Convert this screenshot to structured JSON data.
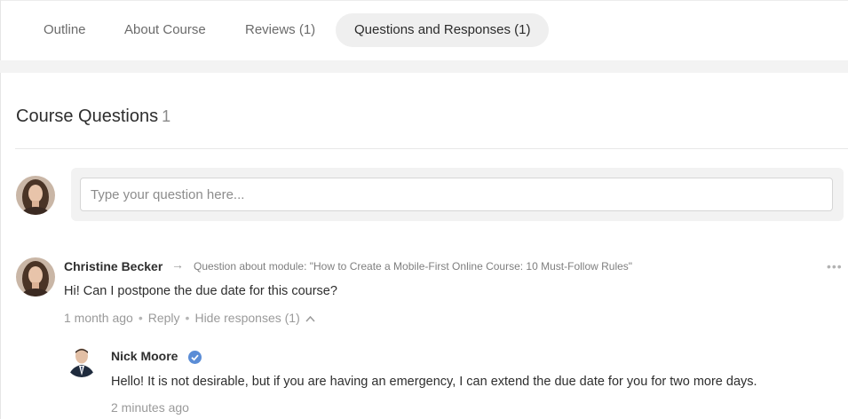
{
  "tabs": [
    {
      "label": "Outline"
    },
    {
      "label": "About Course"
    },
    {
      "label": "Reviews (1)"
    },
    {
      "label": "Questions and Responses (1)",
      "active": true
    }
  ],
  "section": {
    "title": "Course Questions",
    "count": "1"
  },
  "ask": {
    "placeholder": "Type your question here..."
  },
  "question": {
    "author": "Christine Becker",
    "context": "Question about module: \"How to Create a Mobile-First Online Course: 10 Must-Follow Rules\"",
    "text": "Hi! Can I postpone the due date for this course?",
    "time": "1 month ago",
    "reply_label": "Reply",
    "hide_label": "Hide responses (1)",
    "more_label": "•••"
  },
  "response": {
    "author": "Nick Moore",
    "verified_icon": "verified-check-icon",
    "text": "Hello! It is not desirable, but if you are having an emergency,  I can extend the due date for you for two more days.",
    "time": "2 minutes ago"
  },
  "colors": {
    "accent_badge": "#5b8dd6",
    "active_tab_bg": "#efefef"
  }
}
